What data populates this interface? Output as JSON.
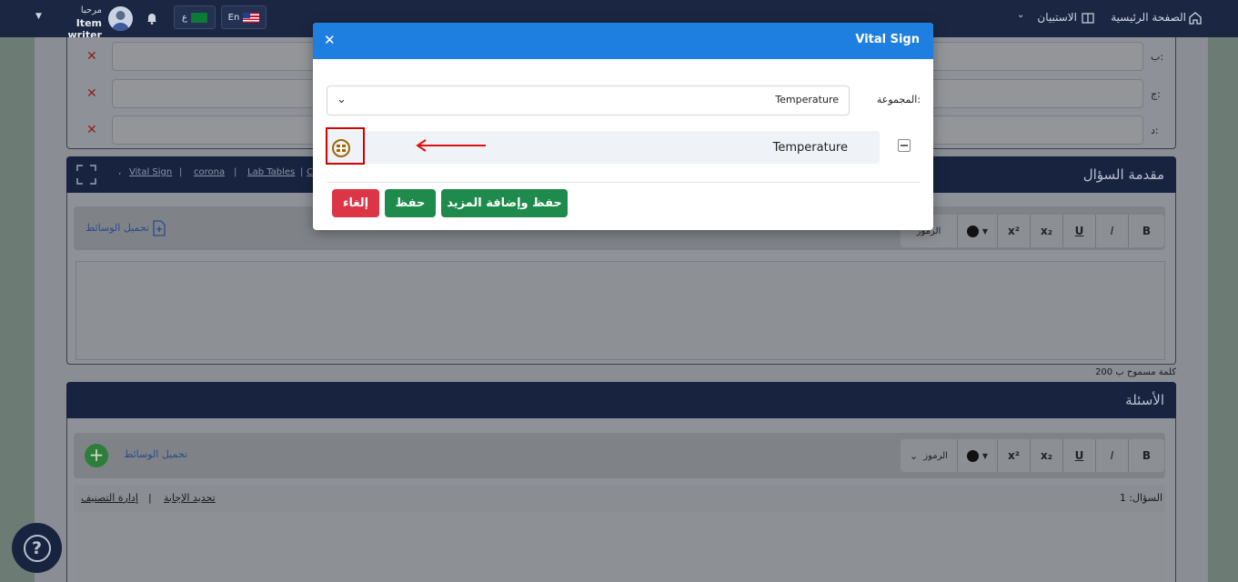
{
  "nav": {
    "home": "الصفحة الرئيسية",
    "questionnaire": "الاستبيان",
    "greeting": "مرحبا",
    "username": "Item writer",
    "lang_en": "En",
    "lang_ar": "ع"
  },
  "options": [
    {
      "label": "ب:"
    },
    {
      "label": "ج:"
    },
    {
      "label": "د:"
    }
  ],
  "intro": {
    "title": "مقدمة السؤال",
    "links": [
      "Vital Sign",
      "corona",
      "Lab Tables",
      "C"
    ],
    "upload_media": "تحميل الوسائط",
    "symbols": "الرموز",
    "word_limit": "200 كلمة مسموح ب"
  },
  "questions": {
    "title": "الأسئلة",
    "upload_media": "تحميل الوسائط",
    "symbols": "الرموز",
    "question_label": "السؤال: 1",
    "set_answer": "تحديد الإجابة",
    "manage_classification": "إدارة التصنيف"
  },
  "toolbar": {
    "bold": "B",
    "italic": "I",
    "underline": "U",
    "subscript": "x₂",
    "superscript": "x²"
  },
  "modal": {
    "title": "Vital Sign",
    "group_label": "المجموعة:",
    "group_value": "Temperature",
    "item_label": "Temperature",
    "save_add_more": "حفظ وإضافة المزيد",
    "save": "حفظ",
    "cancel": "إلغاء"
  },
  "colors": {
    "modal_header": "#1f7fe0",
    "save_green": "#1e8a4c",
    "cancel_red": "#dc3545",
    "highlight_red": "#d40000",
    "icon_gold": "#9b6a00"
  }
}
